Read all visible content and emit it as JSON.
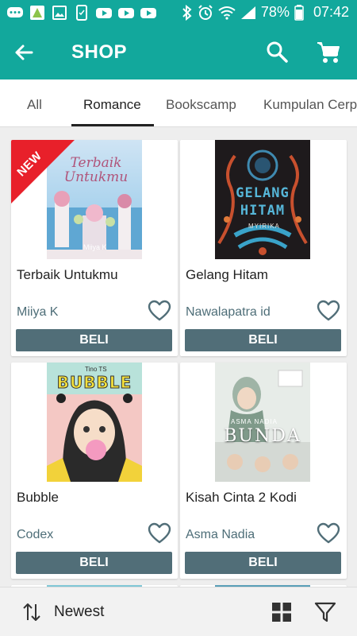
{
  "status_bar": {
    "battery": "78%",
    "time": "07:42"
  },
  "app_bar": {
    "title": "SHOP"
  },
  "tabs": [
    {
      "label": "All",
      "active": false
    },
    {
      "label": "Romance",
      "active": true
    },
    {
      "label": "Bookscamp",
      "active": false
    },
    {
      "label": "Kumpulan Cerpen",
      "active": false
    }
  ],
  "products": [
    {
      "title": "Terbaik Untukmu",
      "author": "Miiya K",
      "buy_label": "BELI",
      "badge": "NEW",
      "cover_text": "Terbaik Untukmu",
      "cover_author": "Miiya K"
    },
    {
      "title": "Gelang Hitam",
      "author": "Nawalapatra id",
      "buy_label": "BELI",
      "cover_text": "GELANG HITAM",
      "cover_author": "MYIRIKA"
    },
    {
      "title": "Bubble",
      "author": "Codex",
      "buy_label": "BELI",
      "cover_text": "BUBBLE",
      "cover_author": "Tino TS"
    },
    {
      "title": "Kisah Cinta 2 Kodi",
      "author": "Asma Nadia",
      "buy_label": "BELI",
      "cover_text": "BUNDA",
      "cover_author": "ASMA NADIA"
    }
  ],
  "bottom_bar": {
    "sort_label": "Newest"
  },
  "colors": {
    "primary": "#12a89c",
    "buy_button": "#516e78",
    "author_text": "#4e6e78",
    "badge": "#e8202a"
  },
  "icons": [
    "back-arrow-icon",
    "search-icon",
    "cart-icon",
    "heart-icon",
    "sort-icon",
    "grid-view-icon",
    "filter-icon"
  ]
}
